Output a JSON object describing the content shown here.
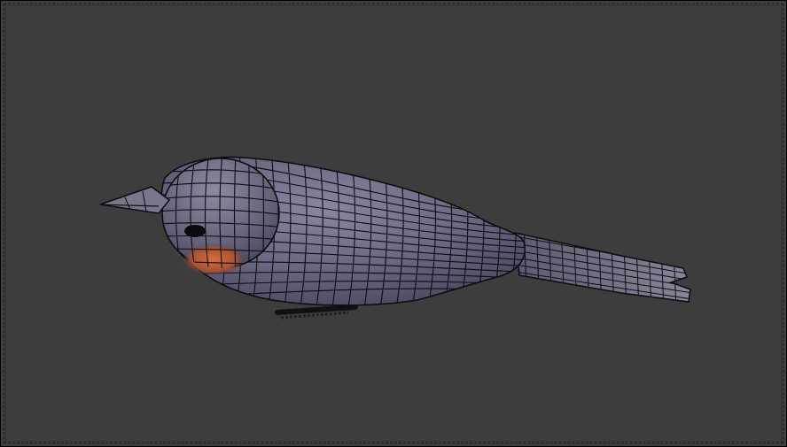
{
  "viewport": {
    "background_color": "#3d3d3d",
    "frame_color": "#1c1c1c"
  },
  "model": {
    "subject": "bird",
    "display_mode": "mesh-wireframe-overlay",
    "body_color": "#6e6a82",
    "breast_color": "#c0623a",
    "wire_color": "#0c0c10"
  }
}
